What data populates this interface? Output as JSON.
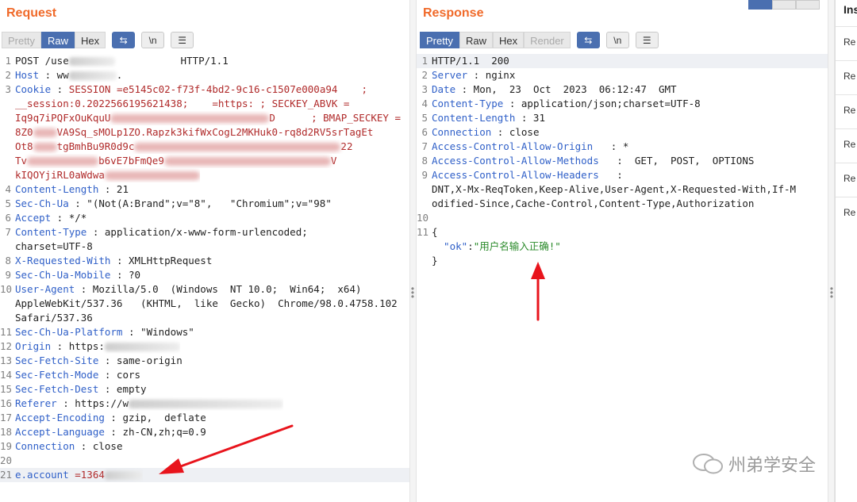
{
  "request": {
    "title": "Request",
    "tabs": [
      "Pretty",
      "Raw",
      "Hex"
    ],
    "lines": [
      [
        {
          "t": "POST /use"
        },
        {
          "b": 58
        },
        {
          "t": "           HTTP/1.1"
        }
      ],
      [
        {
          "t": "Host",
          "c": "k"
        },
        {
          "t": " : ww"
        },
        {
          "b": 60
        },
        {
          "t": "."
        }
      ],
      [
        {
          "t": "Cookie",
          "c": "k"
        },
        {
          "t": " : "
        },
        {
          "t": "SESSION",
          "c": "red"
        },
        {
          "t": " =e5145c02-f73f-4bd2-9c16-c1507e000a94    ;",
          "c": "red"
        }
      ],
      [
        {
          "t": "__session:0.2022566195621438;    =https: ; SECKEY_ABVK =",
          "c": "red"
        }
      ],
      [
        {
          "t": "Iq9q7iPQFxOuKquU",
          "c": "red"
        },
        {
          "p": 200
        },
        {
          "t": "D      ; BMAP_SECKEY =",
          "c": "red"
        }
      ],
      [
        {
          "t": "8Z0",
          "c": "red"
        },
        {
          "p": 30
        },
        {
          "t": "VA9Sq_sMOLp1ZO.Rapzk3kifWxCogL2MKHuk0-rq8d2RV5srTagEt",
          "c": "red"
        }
      ],
      [
        {
          "t": "Ot8",
          "c": "red"
        },
        {
          "p": 30
        },
        {
          "t": "tgBmhBu9R0d9c",
          "c": "red"
        },
        {
          "p": 260
        },
        {
          "t": "22",
          "c": "red"
        }
      ],
      [
        {
          "t": "Tv",
          "c": "red"
        },
        {
          "p": 90
        },
        {
          "t": "b6vE7bFmQe9",
          "c": "red"
        },
        {
          "p": 210
        },
        {
          "t": "V",
          "c": "red"
        }
      ],
      [
        {
          "t": "kIQOYjiRL0aWdwa",
          "c": "red"
        },
        {
          "p": 120
        }
      ],
      [
        {
          "t": "Content-Length",
          "c": "k"
        },
        {
          "t": " : 21"
        }
      ],
      [
        {
          "t": "Sec-Ch-Ua",
          "c": "k"
        },
        {
          "t": " : \"(Not(A:Brand\";v=\"8\",   \"Chromium\";v=\"98\""
        }
      ],
      [
        {
          "t": "Accept",
          "c": "k"
        },
        {
          "t": " : */*"
        }
      ],
      [
        {
          "t": "Content-Type",
          "c": "k"
        },
        {
          "t": " : application/x-www-form-urlencoded;"
        }
      ],
      [
        {
          "t": "charset=UTF-8"
        }
      ],
      [
        {
          "t": "X-Requested-With",
          "c": "k"
        },
        {
          "t": " : XMLHttpRequest"
        }
      ],
      [
        {
          "t": "Sec-Ch-Ua-Mobile",
          "c": "k"
        },
        {
          "t": " : ?0"
        }
      ],
      [
        {
          "t": "User-Agent",
          "c": "k"
        },
        {
          "t": " : Mozilla/5.0  (Windows  NT 10.0;  Win64;  x64)"
        }
      ],
      [
        {
          "t": "AppleWebKit/537.36   (KHTML,  like  Gecko)  Chrome/98.0.4758.102"
        }
      ],
      [
        {
          "t": "Safari/537.36"
        }
      ],
      [
        {
          "t": "Sec-Ch-Ua-Platform",
          "c": "k"
        },
        {
          "t": " : \"Windows\""
        }
      ],
      [
        {
          "t": "Origin",
          "c": "k"
        },
        {
          "t": " : https:"
        },
        {
          "b": 95
        }
      ],
      [
        {
          "t": "Sec-Fetch-Site",
          "c": "k"
        },
        {
          "t": " : same-origin"
        }
      ],
      [
        {
          "t": "Sec-Fetch-Mode",
          "c": "k"
        },
        {
          "t": " : cors"
        }
      ],
      [
        {
          "t": "Sec-Fetch-Dest",
          "c": "k"
        },
        {
          "t": " : empty"
        }
      ],
      [
        {
          "t": "Referer",
          "c": "k"
        },
        {
          "t": " : https://w"
        },
        {
          "b": 195
        }
      ],
      [
        {
          "t": "Accept-Encoding",
          "c": "k"
        },
        {
          "t": " : gzip,  deflate"
        }
      ],
      [
        {
          "t": "Accept-Language",
          "c": "k"
        },
        {
          "t": " : zh-CN,zh;q=0.9"
        }
      ],
      [
        {
          "t": "Connection",
          "c": "k"
        },
        {
          "t": " : close"
        }
      ],
      [],
      [
        {
          "t": "e.account",
          "c": "k"
        },
        {
          "t": " =1364",
          "c": "red"
        },
        {
          "b": 48
        }
      ]
    ],
    "line_numbers": [
      "1",
      "2",
      "3",
      "",
      "",
      "",
      "",
      "",
      "",
      "4",
      "5",
      "6",
      "7",
      "",
      "8",
      "9",
      "10",
      "",
      "",
      "11",
      "12",
      "13",
      "14",
      "15",
      "16",
      "17",
      "18",
      "19",
      "20",
      "21"
    ]
  },
  "response": {
    "title": "Response",
    "tabs": [
      "Pretty",
      "Raw",
      "Hex",
      "Render"
    ],
    "lines": [
      [
        {
          "t": "HTTP/1.1  200"
        }
      ],
      [
        {
          "t": "Server",
          "c": "k"
        },
        {
          "t": " : nginx"
        }
      ],
      [
        {
          "t": "Date",
          "c": "k"
        },
        {
          "t": " : Mon,  23  Oct  2023  06:12:47  GMT"
        }
      ],
      [
        {
          "t": "Content-Type",
          "c": "k"
        },
        {
          "t": " : application/json;charset=UTF-8"
        }
      ],
      [
        {
          "t": "Content-Length",
          "c": "k"
        },
        {
          "t": " : 31"
        }
      ],
      [
        {
          "t": "Connection",
          "c": "k"
        },
        {
          "t": " : close"
        }
      ],
      [
        {
          "t": "Access-Control-Allow-Origin",
          "c": "k"
        },
        {
          "t": "   : *"
        }
      ],
      [
        {
          "t": "Access-Control-Allow-Methods",
          "c": "k"
        },
        {
          "t": "   :  GET,  POST,  OPTIONS"
        }
      ],
      [
        {
          "t": "Access-Control-Allow-Headers",
          "c": "k"
        },
        {
          "t": "   :"
        }
      ],
      [
        {
          "t": "DNT,X-Mx-ReqToken,Keep-Alive,User-Agent,X-Requested-With,If-M"
        }
      ],
      [
        {
          "t": "odified-Since,Cache-Control,Content-Type,Authorization"
        }
      ],
      [],
      [
        {
          "t": "{"
        }
      ],
      [
        {
          "t": "  \"ok\"",
          "c": "k"
        },
        {
          "t": ":"
        },
        {
          "t": "\"用户名输入正确!\"",
          "c": "strv"
        }
      ],
      [
        {
          "t": "}"
        }
      ]
    ],
    "line_numbers": [
      "1",
      "2",
      "3",
      "4",
      "5",
      "6",
      "7",
      "8",
      "9",
      "",
      "",
      "10",
      "11",
      "",
      ""
    ]
  },
  "inspector": {
    "title": "Ins",
    "rows": [
      "Re",
      "Re",
      "Re",
      "Re",
      "Re",
      "Re"
    ]
  },
  "watermark": "州弟学安全",
  "colors": {
    "accent": "#4a6fb0",
    "title": "#f06a2a",
    "header_key": "#3060c8",
    "cookie": "#b02a2a",
    "arrow": "#e8141c"
  }
}
